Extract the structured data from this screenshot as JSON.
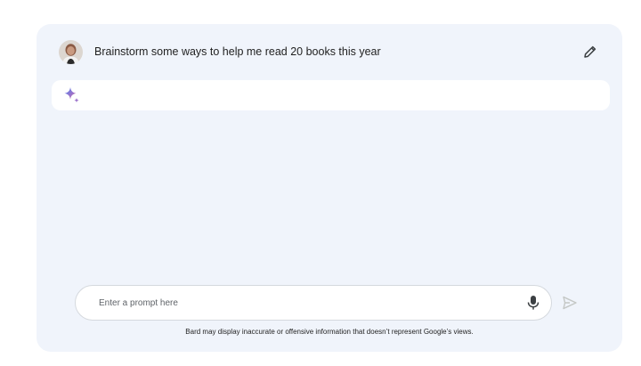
{
  "conversation": {
    "user_prompt": "Brainstorm some ways to help me read 20 books this year",
    "avatar_icon": "user-avatar-photo",
    "edit_icon": "pencil-icon",
    "response_icon": "bard-sparkle-icon"
  },
  "composer": {
    "placeholder": "Enter a prompt here",
    "value": "",
    "mic_icon": "microphone-icon",
    "send_icon": "send-icon"
  },
  "footer": {
    "disclaimer": "Bard may display inaccurate or offensive information that doesn’t represent Google’s views."
  },
  "colors": {
    "panel_bg": "#f0f4fb",
    "spark_blue": "#4e82ee",
    "spark_red": "#d96570",
    "send_disabled": "#c4c7c5"
  }
}
